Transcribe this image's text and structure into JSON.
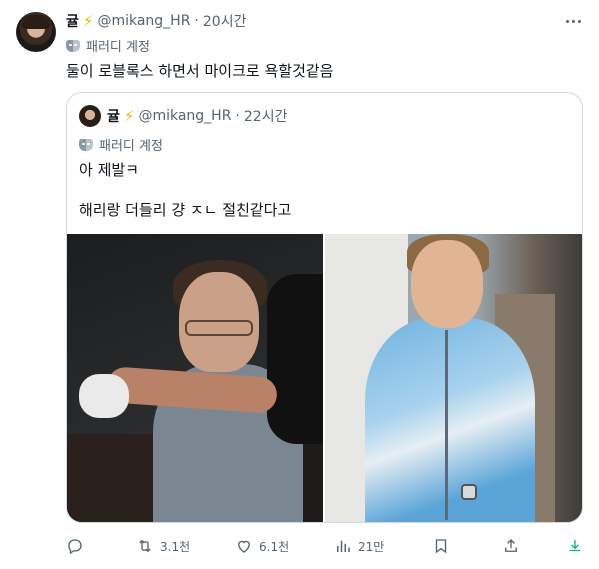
{
  "tweet": {
    "name": "귤",
    "handle": "@mikang_HR",
    "dot": "·",
    "time": "20시간",
    "parody_label": "패러디 계정",
    "text": "둘이 로블록스 하면서 마이크로 욕할것같음"
  },
  "quote": {
    "name": "귤",
    "handle": "@mikang_HR",
    "dot": "·",
    "time": "22시간",
    "parody_label": "패러디 계정",
    "line1": "아 제발ㅋ",
    "line2": "해리랑 더들리 걍 ㅈㄴ 절친같다고"
  },
  "actions": {
    "reply_count": "",
    "retweet_count": "3.1천",
    "like_count": "6.1천",
    "views_count": "21만"
  },
  "colors": {
    "text_primary": "#0f1419",
    "text_secondary": "#536471",
    "border": "#cfd9de",
    "bolt": "#f4b400",
    "download_icon": "#00ba7c"
  },
  "icons": [
    "bolt-icon",
    "more-icon",
    "parody-mask-icon",
    "reply-icon",
    "retweet-icon",
    "like-icon",
    "views-icon",
    "bookmark-icon",
    "share-icon",
    "download-icon"
  ]
}
